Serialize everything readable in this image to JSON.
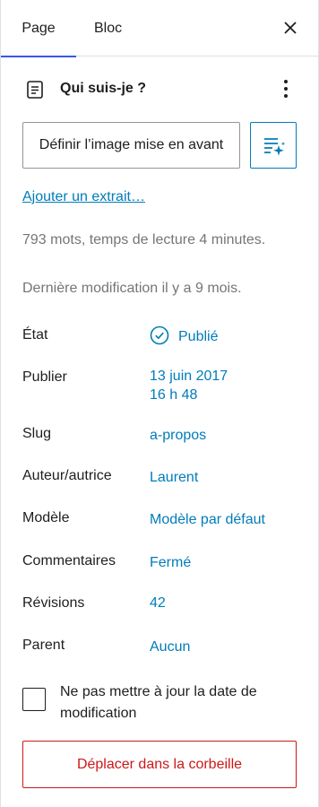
{
  "tabs": [
    {
      "label": "Page"
    },
    {
      "label": "Bloc"
    }
  ],
  "page": {
    "title": "Qui suis-je ?"
  },
  "featured_image_label": "Définir l’image mise en avant",
  "excerpt_link": "Ajouter un extrait…",
  "stats": {
    "words_reading": "793 mots, temps de lecture 4 minutes.",
    "last_modified": "Dernière modification il y a 9 mois."
  },
  "rows": {
    "status": {
      "label": "État",
      "value": "Publié"
    },
    "publish": {
      "label": "Publier",
      "date": "13 juin 2017",
      "time": "16 h 48"
    },
    "slug": {
      "label": "Slug",
      "value": "a-propos"
    },
    "author": {
      "label": "Auteur/autrice",
      "value": "Laurent"
    },
    "template": {
      "label": "Modèle",
      "value": "Modèle par défaut"
    },
    "comments": {
      "label": "Commentaires",
      "value": "Fermé"
    },
    "revisions": {
      "label": "Révisions",
      "value": "42"
    },
    "parent": {
      "label": "Parent",
      "value": "Aucun"
    }
  },
  "checkbox_label": "Ne pas mettre à jour la date de modification",
  "checkbox_checked": false,
  "trash_label": "Déplacer dans la corbeille",
  "colors": {
    "accent": "#3858e9",
    "link": "#007cba",
    "danger": "#cc1818",
    "muted": "#757575",
    "text": "#1e1e1e"
  },
  "icons": {
    "close": "close-icon",
    "page": "page-icon",
    "more": "more-vertical-icon",
    "ai": "ai-sparkle-list-icon",
    "status": "check-circle-icon"
  }
}
